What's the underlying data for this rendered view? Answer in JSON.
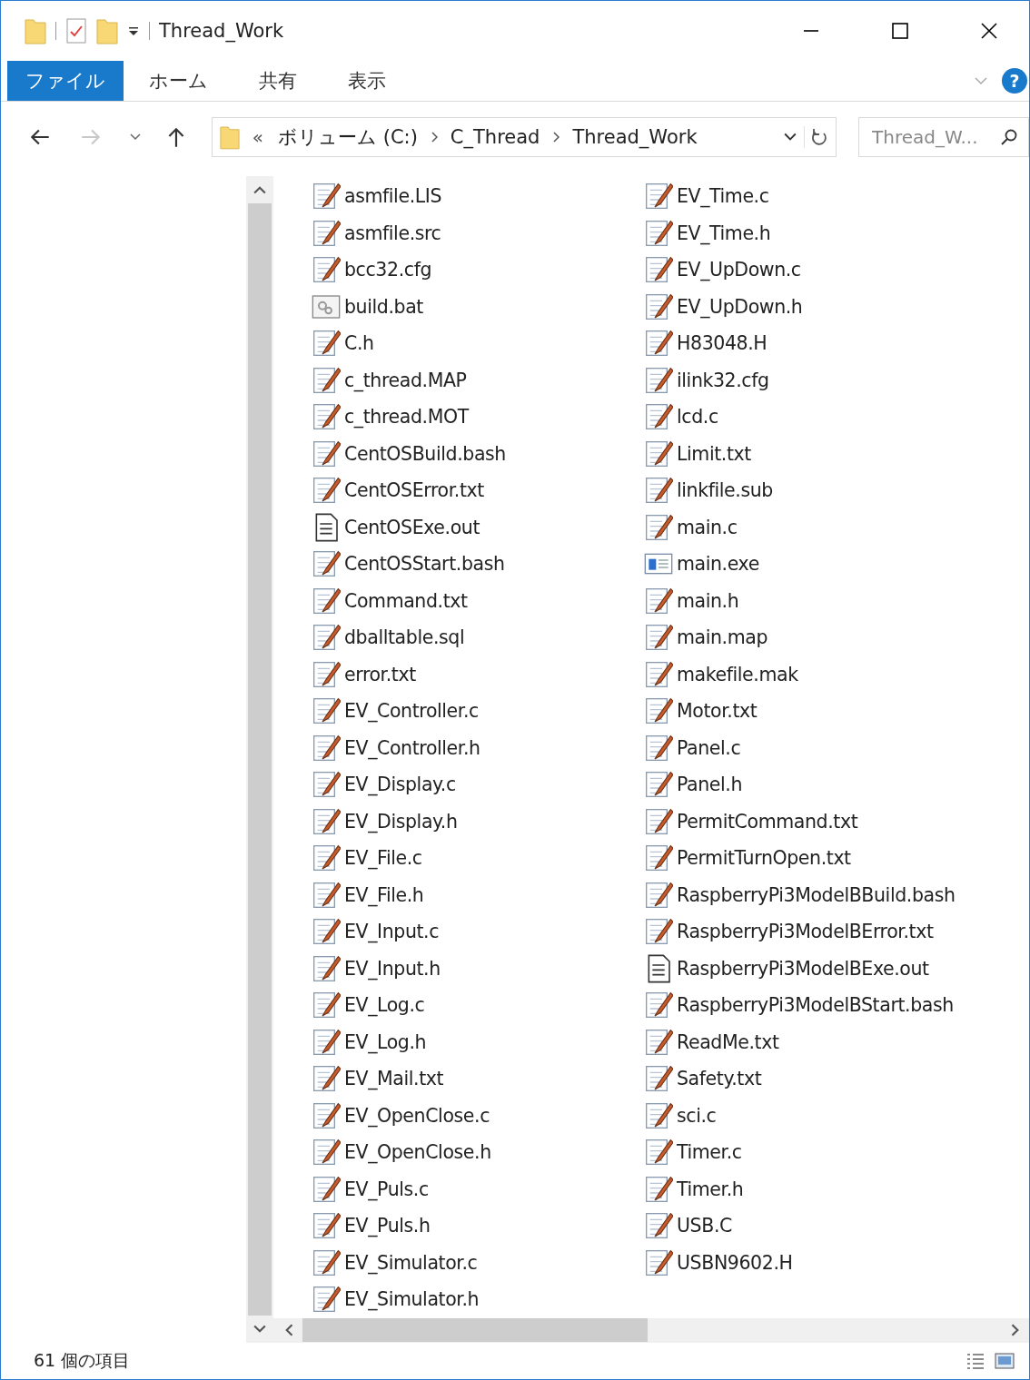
{
  "window": {
    "title": "Thread_Work"
  },
  "ribbon": {
    "tabs": [
      {
        "label": "ファイル",
        "selected": true
      },
      {
        "label": "ホーム",
        "selected": false
      },
      {
        "label": "共有",
        "selected": false
      },
      {
        "label": "表示",
        "selected": false
      }
    ],
    "help": "?"
  },
  "nav": {
    "forward_disabled": true
  },
  "address": {
    "overflow": "«",
    "crumbs": [
      "ボリューム (C:)",
      "C_Thread",
      "Thread_Work"
    ]
  },
  "search": {
    "placeholder": "Thread_W..."
  },
  "files": [
    {
      "name": "asmfile.LIS",
      "kind": "text"
    },
    {
      "name": "asmfile.src",
      "kind": "text"
    },
    {
      "name": "bcc32.cfg",
      "kind": "text"
    },
    {
      "name": "build.bat",
      "kind": "batch"
    },
    {
      "name": "C.h",
      "kind": "text"
    },
    {
      "name": "c_thread.MAP",
      "kind": "text"
    },
    {
      "name": "c_thread.MOT",
      "kind": "text"
    },
    {
      "name": "CentOSBuild.bash",
      "kind": "text"
    },
    {
      "name": "CentOSError.txt",
      "kind": "text"
    },
    {
      "name": "CentOSExe.out",
      "kind": "document"
    },
    {
      "name": "CentOSStart.bash",
      "kind": "text"
    },
    {
      "name": "Command.txt",
      "kind": "text"
    },
    {
      "name": "dballtable.sql",
      "kind": "text"
    },
    {
      "name": "error.txt",
      "kind": "text"
    },
    {
      "name": "EV_Controller.c",
      "kind": "text"
    },
    {
      "name": "EV_Controller.h",
      "kind": "text"
    },
    {
      "name": "EV_Display.c",
      "kind": "text"
    },
    {
      "name": "EV_Display.h",
      "kind": "text"
    },
    {
      "name": "EV_File.c",
      "kind": "text"
    },
    {
      "name": "EV_File.h",
      "kind": "text"
    },
    {
      "name": "EV_Input.c",
      "kind": "text"
    },
    {
      "name": "EV_Input.h",
      "kind": "text"
    },
    {
      "name": "EV_Log.c",
      "kind": "text"
    },
    {
      "name": "EV_Log.h",
      "kind": "text"
    },
    {
      "name": "EV_Mail.txt",
      "kind": "text"
    },
    {
      "name": "EV_OpenClose.c",
      "kind": "text"
    },
    {
      "name": "EV_OpenClose.h",
      "kind": "text"
    },
    {
      "name": "EV_Puls.c",
      "kind": "text"
    },
    {
      "name": "EV_Puls.h",
      "kind": "text"
    },
    {
      "name": "EV_Simulator.c",
      "kind": "text"
    },
    {
      "name": "EV_Simulator.h",
      "kind": "text"
    },
    {
      "name": "EV_Time.c",
      "kind": "text"
    },
    {
      "name": "EV_Time.h",
      "kind": "text"
    },
    {
      "name": "EV_UpDown.c",
      "kind": "text"
    },
    {
      "name": "EV_UpDown.h",
      "kind": "text"
    },
    {
      "name": "H83048.H",
      "kind": "text"
    },
    {
      "name": "ilink32.cfg",
      "kind": "text"
    },
    {
      "name": "lcd.c",
      "kind": "text"
    },
    {
      "name": "Limit.txt",
      "kind": "text"
    },
    {
      "name": "linkfile.sub",
      "kind": "text"
    },
    {
      "name": "main.c",
      "kind": "text"
    },
    {
      "name": "main.exe",
      "kind": "exe"
    },
    {
      "name": "main.h",
      "kind": "text"
    },
    {
      "name": "main.map",
      "kind": "text"
    },
    {
      "name": "makefile.mak",
      "kind": "text"
    },
    {
      "name": "Motor.txt",
      "kind": "text"
    },
    {
      "name": "Panel.c",
      "kind": "text"
    },
    {
      "name": "Panel.h",
      "kind": "text"
    },
    {
      "name": "PermitCommand.txt",
      "kind": "text"
    },
    {
      "name": "PermitTurnOpen.txt",
      "kind": "text"
    },
    {
      "name": "RaspberryPi3ModelBBuild.bash",
      "kind": "text"
    },
    {
      "name": "RaspberryPi3ModelBError.txt",
      "kind": "text"
    },
    {
      "name": "RaspberryPi3ModelBExe.out",
      "kind": "document"
    },
    {
      "name": "RaspberryPi3ModelBStart.bash",
      "kind": "text"
    },
    {
      "name": "ReadMe.txt",
      "kind": "text"
    },
    {
      "name": "Safety.txt",
      "kind": "text"
    },
    {
      "name": "sci.c",
      "kind": "text"
    },
    {
      "name": "Timer.c",
      "kind": "text"
    },
    {
      "name": "Timer.h",
      "kind": "text"
    },
    {
      "name": "USB.C",
      "kind": "text"
    },
    {
      "name": "USBN9602.H",
      "kind": "text"
    }
  ],
  "status_bar": {
    "count": "61 個の項目"
  }
}
